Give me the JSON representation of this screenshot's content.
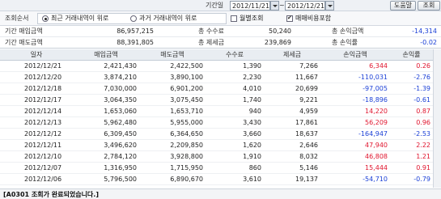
{
  "header": {
    "period_label": "기간일",
    "start_date": "2012/11/21",
    "tilde": "~",
    "end_date": "2012/12/21",
    "help_button": "도움말",
    "query_button": "조회"
  },
  "options": {
    "sort_label": "조회순서",
    "radio_recent": "최근 거래내역이 위로",
    "radio_past": "과거 거래내역이 위로",
    "radio_selected": "recent",
    "monthly_label": "월별조회",
    "monthly_checked": false,
    "include_fees_label": "매매비용포함",
    "include_fees_checked": true
  },
  "summary": {
    "row1": {
      "buy_label": "기간 매입금액",
      "buy_value": "86,957,215",
      "fee_label": "총 수수료",
      "fee_value": "50,240",
      "pl_label": "총 손익금액",
      "pl_value": "-14,314"
    },
    "row2": {
      "sell_label": "기간 매도금액",
      "sell_value": "88,391,805",
      "tax_label": "총 제세금",
      "tax_value": "239,869",
      "rate_label": "총 손익률",
      "rate_value": "-0.02"
    }
  },
  "table": {
    "columns": [
      "일자",
      "매입금액",
      "매도금액",
      "수수료",
      "제세금",
      "손익금액",
      "손익률"
    ],
    "rows": [
      {
        "date": "2012/12/21",
        "buy": "2,421,430",
        "sell": "2,422,500",
        "fee": "1,390",
        "tax": "7,266",
        "pl": "6,344",
        "rate": "0.26",
        "sign": "pos"
      },
      {
        "date": "2012/12/20",
        "buy": "3,874,210",
        "sell": "3,890,100",
        "fee": "2,230",
        "tax": "11,667",
        "pl": "-110,031",
        "rate": "-2.76",
        "sign": "neg"
      },
      {
        "date": "2012/12/18",
        "buy": "7,030,000",
        "sell": "6,901,200",
        "fee": "4,010",
        "tax": "20,699",
        "pl": "-97,005",
        "rate": "-1.39",
        "sign": "neg"
      },
      {
        "date": "2012/12/17",
        "buy": "3,064,350",
        "sell": "3,075,450",
        "fee": "1,740",
        "tax": "9,221",
        "pl": "-18,896",
        "rate": "-0.61",
        "sign": "neg"
      },
      {
        "date": "2012/12/14",
        "buy": "1,653,060",
        "sell": "1,653,710",
        "fee": "940",
        "tax": "4,959",
        "pl": "14,220",
        "rate": "0.87",
        "sign": "pos"
      },
      {
        "date": "2012/12/13",
        "buy": "5,962,480",
        "sell": "5,955,000",
        "fee": "3,430",
        "tax": "17,861",
        "pl": "56,209",
        "rate": "0.96",
        "sign": "pos"
      },
      {
        "date": "2012/12/12",
        "buy": "6,309,450",
        "sell": "6,364,650",
        "fee": "3,660",
        "tax": "18,637",
        "pl": "-164,947",
        "rate": "-2.53",
        "sign": "neg"
      },
      {
        "date": "2012/12/11",
        "buy": "3,496,620",
        "sell": "2,209,850",
        "fee": "1,620",
        "tax": "2,646",
        "pl": "47,940",
        "rate": "2.22",
        "sign": "pos"
      },
      {
        "date": "2012/12/10",
        "buy": "2,784,120",
        "sell": "3,928,800",
        "fee": "1,910",
        "tax": "8,032",
        "pl": "46,808",
        "rate": "1.21",
        "sign": "pos"
      },
      {
        "date": "2012/12/07",
        "buy": "1,316,950",
        "sell": "1,715,950",
        "fee": "860",
        "tax": "5,146",
        "pl": "15,444",
        "rate": "0.91",
        "sign": "pos"
      },
      {
        "date": "2012/12/06",
        "buy": "5,796,500",
        "sell": "6,890,670",
        "fee": "3,610",
        "tax": "19,137",
        "pl": "-54,710",
        "rate": "-0.79",
        "sign": "neg"
      }
    ]
  },
  "status": {
    "text": "[A0301 조회가 완료되었습니다.]"
  },
  "colors": {
    "positive": "#e0152e",
    "negative": "#1a3fd6"
  }
}
